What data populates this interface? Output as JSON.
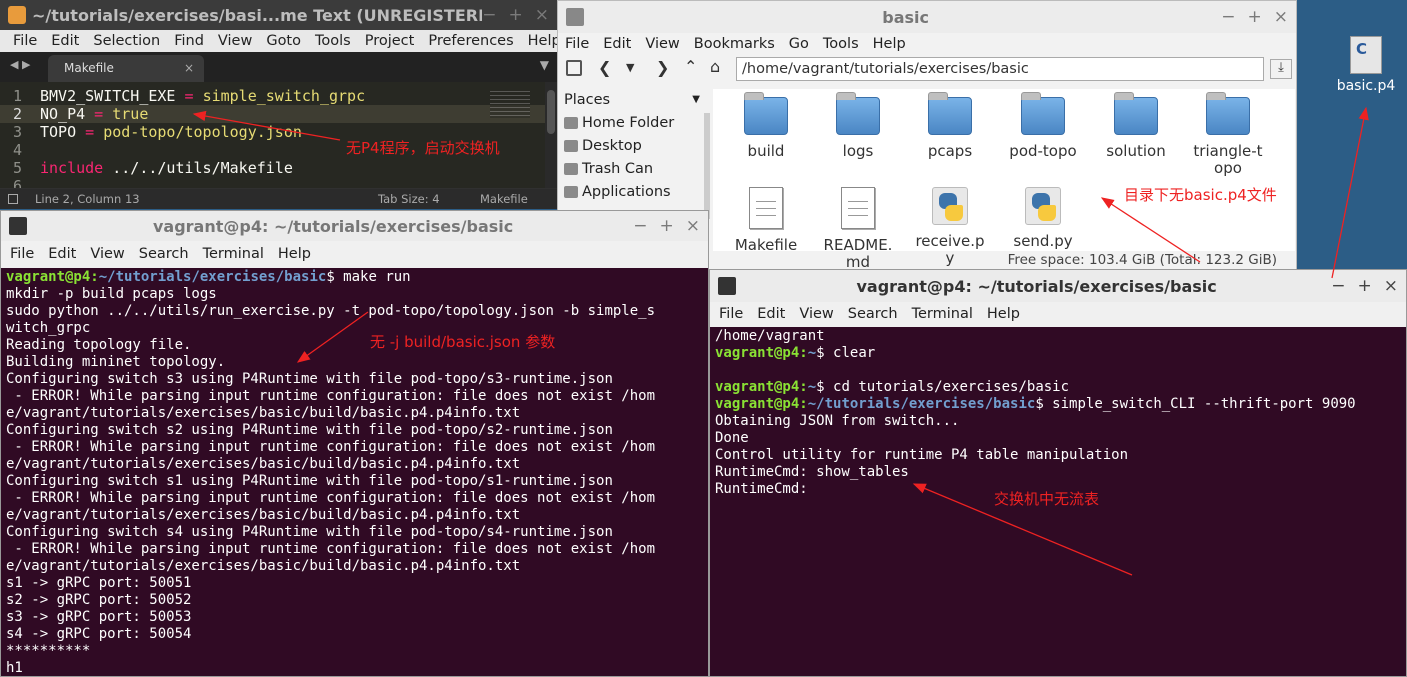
{
  "editor": {
    "title": "~/tutorials/exercises/basi...me Text (UNREGISTERED)",
    "menu": [
      "File",
      "Edit",
      "Selection",
      "Find",
      "View",
      "Goto",
      "Tools",
      "Project",
      "Preferences",
      "Help"
    ],
    "tab": "Makefile",
    "lines": [
      {
        "n": "1",
        "k": "BMV2_SWITCH_EXE",
        "op": " = ",
        "v": "simple_switch_grpc"
      },
      {
        "n": "2",
        "k": "NO_P4",
        "op": " = ",
        "v": "true"
      },
      {
        "n": "3",
        "k": "TOPO",
        "op": " = ",
        "v": "pod-topo/topology.json"
      },
      {
        "n": "4",
        "k": "",
        "op": "",
        "v": ""
      },
      {
        "n": "5",
        "k": "include",
        "op": " ",
        "v": "../../utils/Makefile"
      },
      {
        "n": "6",
        "k": "",
        "op": "",
        "v": ""
      }
    ],
    "status": {
      "position": "Line 2, Column 13",
      "tab_size": "Tab Size: 4",
      "syntax": "Makefile"
    },
    "annotation": "无P4程序，启动交换机"
  },
  "files": {
    "title": "basic",
    "menu": [
      "File",
      "Edit",
      "View",
      "Bookmarks",
      "Go",
      "Tools",
      "Help"
    ],
    "path": "/home/vagrant/tutorials/exercises/basic",
    "places_label": "Places",
    "places": [
      "Home Folder",
      "Desktop",
      "Trash Can",
      "Applications"
    ],
    "items": [
      {
        "name": "build",
        "kind": "folder"
      },
      {
        "name": "logs",
        "kind": "folder"
      },
      {
        "name": "pcaps",
        "kind": "folder"
      },
      {
        "name": "pod-topo",
        "kind": "folder"
      },
      {
        "name": "solution",
        "kind": "folder"
      },
      {
        "name": "triangle-topo",
        "kind": "folder"
      },
      {
        "name": "Makefile",
        "kind": "doc"
      },
      {
        "name": "README.md",
        "kind": "doc"
      },
      {
        "name": "receive.py",
        "kind": "python"
      },
      {
        "name": "send.py",
        "kind": "python"
      }
    ],
    "status": "Free space: 103.4 GiB (Total: 123.2 GiB)",
    "annotation": "目录下无basic.p4文件"
  },
  "term1": {
    "title": "vagrant@p4: ~/tutorials/exercises/basic",
    "menu": [
      "File",
      "Edit",
      "View",
      "Search",
      "Terminal",
      "Help"
    ],
    "prompt_user": "vagrant@p4",
    "prompt_path": "~/tutorials/exercises/basic",
    "command": "make run",
    "lines": [
      "mkdir -p build pcaps logs",
      "sudo python ../../utils/run_exercise.py -t pod-topo/topology.json -b simple_s",
      "witch_grpc",
      "Reading topology file.",
      "Building mininet topology.",
      "Configuring switch s3 using P4Runtime with file pod-topo/s3-runtime.json",
      " - ERROR! While parsing input runtime configuration: file does not exist /hom",
      "e/vagrant/tutorials/exercises/basic/build/basic.p4.p4info.txt",
      "Configuring switch s2 using P4Runtime with file pod-topo/s2-runtime.json",
      " - ERROR! While parsing input runtime configuration: file does not exist /hom",
      "e/vagrant/tutorials/exercises/basic/build/basic.p4.p4info.txt",
      "Configuring switch s1 using P4Runtime with file pod-topo/s1-runtime.json",
      " - ERROR! While parsing input runtime configuration: file does not exist /hom",
      "e/vagrant/tutorials/exercises/basic/build/basic.p4.p4info.txt",
      "Configuring switch s4 using P4Runtime with file pod-topo/s4-runtime.json",
      " - ERROR! While parsing input runtime configuration: file does not exist /hom",
      "e/vagrant/tutorials/exercises/basic/build/basic.p4.p4info.txt",
      "s1 -> gRPC port: 50051",
      "s2 -> gRPC port: 50052",
      "s3 -> gRPC port: 50053",
      "s4 -> gRPC port: 50054",
      "**********",
      "h1"
    ],
    "annotation": "无 -j build/basic.json 参数"
  },
  "term2": {
    "title": "vagrant@p4: ~/tutorials/exercises/basic",
    "menu": [
      "File",
      "Edit",
      "View",
      "Search",
      "Terminal",
      "Help"
    ],
    "line0": "/home/vagrant",
    "p1_user": "vagrant@p4",
    "p1_path": "~",
    "p1_cmd": "clear",
    "p2_user": "vagrant@p4",
    "p2_path": "~",
    "p2_cmd": "cd tutorials/exercises/basic",
    "p3_user": "vagrant@p4",
    "p3_path": "~/tutorials/exercises/basic",
    "p3_cmd": "simple_switch_CLI --thrift-port 9090",
    "lines": [
      "Obtaining JSON from switch...",
      "Done",
      "Control utility for runtime P4 table manipulation",
      "RuntimeCmd: show_tables",
      "RuntimeCmd:"
    ],
    "annotation": "交换机中无流表"
  },
  "desktop": {
    "file_label": "basic.p4"
  }
}
